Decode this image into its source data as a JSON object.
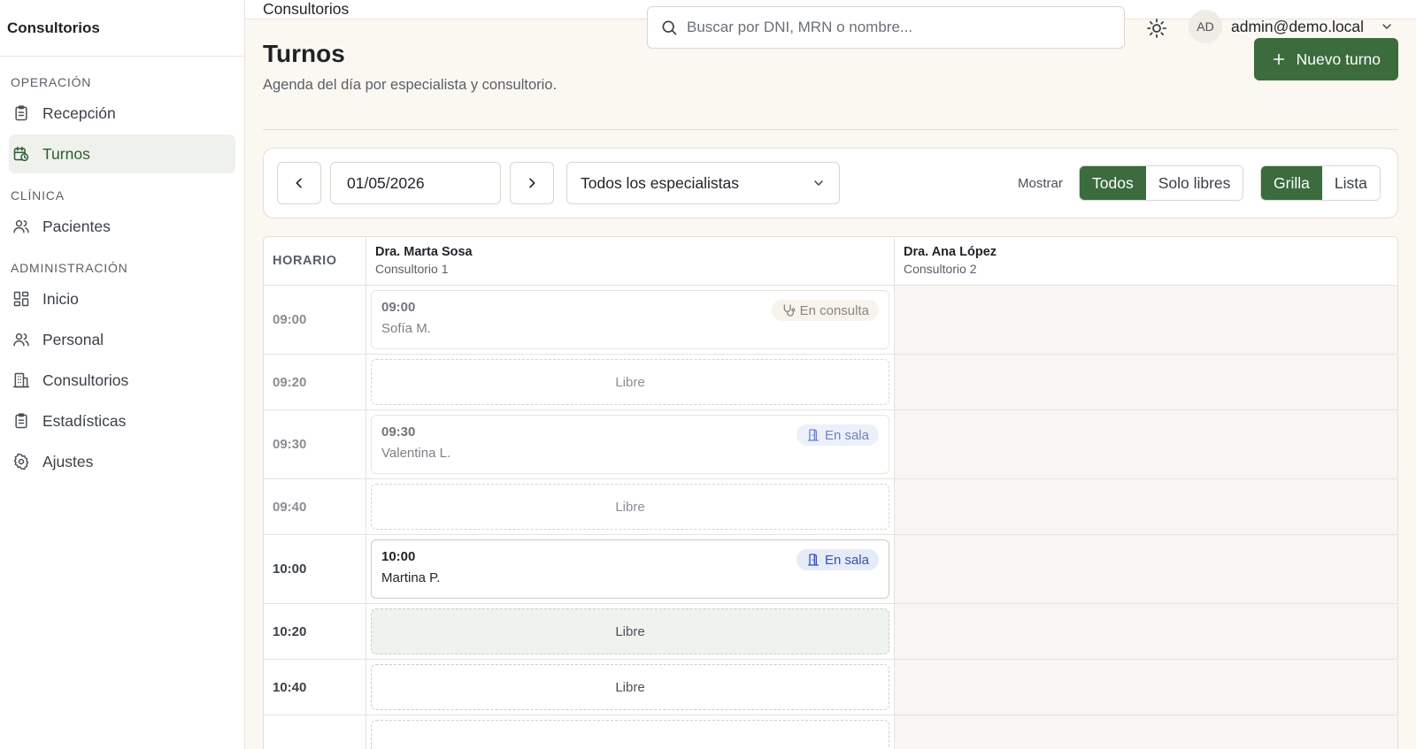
{
  "app": {
    "brand": "Consultorios"
  },
  "sidebar": {
    "sections": [
      {
        "title": "OPERACIÓN",
        "items": [
          {
            "label": "Recepción",
            "icon": "clipboard-icon"
          },
          {
            "label": "Turnos",
            "icon": "calendar-clock-icon",
            "active": true
          }
        ]
      },
      {
        "title": "CLÍNICA",
        "items": [
          {
            "label": "Pacientes",
            "icon": "users-icon"
          }
        ]
      },
      {
        "title": "ADMINISTRACIÓN",
        "items": [
          {
            "label": "Inicio",
            "icon": "dashboard-icon"
          },
          {
            "label": "Personal",
            "icon": "users-icon"
          },
          {
            "label": "Consultorios",
            "icon": "building-icon"
          },
          {
            "label": "Estadísticas",
            "icon": "clipboard-icon"
          },
          {
            "label": "Ajustes",
            "icon": "gear-icon"
          }
        ]
      }
    ]
  },
  "topbar": {
    "title": "Consultorios",
    "search_placeholder": "Buscar por DNI, MRN o nombre...",
    "avatar_initials": "AD",
    "user_email": "admin@demo.local"
  },
  "page": {
    "title": "Turnos",
    "subtitle": "Agenda del día por especialista y consultorio.",
    "new_button": "Nuevo turno"
  },
  "toolbar": {
    "date": "01/05/2026",
    "specialist_select": "Todos los especialistas",
    "show_label": "Mostrar",
    "filter_options": [
      "Todos",
      "Solo libres"
    ],
    "filter_selected": "Todos",
    "view_options": [
      "Grilla",
      "Lista"
    ],
    "view_selected": "Grilla"
  },
  "grid": {
    "time_header": "HORARIO",
    "columns": [
      {
        "doctor": "Dra. Marta Sosa",
        "room": "Consultorio 1"
      },
      {
        "doctor": "Dra. Ana López",
        "room": "Consultorio 2"
      }
    ],
    "rows": [
      {
        "time": "09:00",
        "slot": {
          "time": "09:00",
          "patient": "Sofía M.",
          "status": "En consulta",
          "status_icon": "stethoscope-icon"
        }
      },
      {
        "time": "09:20",
        "free": "Libre"
      },
      {
        "time": "09:30",
        "slot": {
          "time": "09:30",
          "patient": "Valentina L.",
          "status": "En sala",
          "status_icon": "door-icon"
        }
      },
      {
        "time": "09:40",
        "free": "Libre"
      },
      {
        "time": "10:00",
        "slot": {
          "time": "10:00",
          "patient": "Martina P.",
          "status": "En sala",
          "status_icon": "door-icon"
        }
      },
      {
        "time": "10:20",
        "free": "Libre"
      },
      {
        "time": "10:40",
        "free": "Libre"
      }
    ]
  },
  "colors": {
    "accent": "#3c6b3d",
    "page_bg": "#fbf8f2",
    "badge_sala": "#3651b0"
  }
}
